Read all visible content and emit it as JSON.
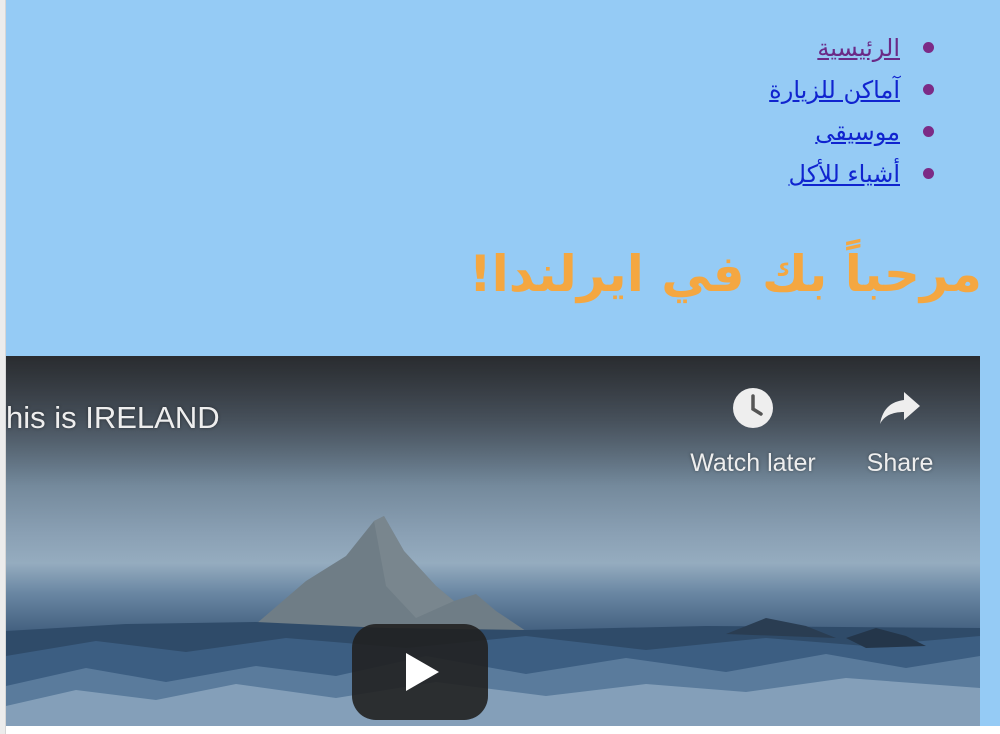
{
  "nav": {
    "items": [
      {
        "label": "الرئيسية",
        "visited": true
      },
      {
        "label": "آماكن للزيارة",
        "visited": false
      },
      {
        "label": "موسيقى",
        "visited": false
      },
      {
        "label": "أشياء للأكل",
        "visited": false
      }
    ]
  },
  "heading": "مرحباً بك في ايرلندا!",
  "video": {
    "title": "his is IRELAND",
    "watch_later_label": "Watch later",
    "share_label": "Share",
    "icons": {
      "watch_later": "clock-icon",
      "share": "share-arrow-icon",
      "play": "play-icon"
    }
  },
  "colors": {
    "page_background": "#95cbf5",
    "heading": "#f4a741",
    "link": "#1024cf",
    "visited_link": "#6a2a87"
  }
}
